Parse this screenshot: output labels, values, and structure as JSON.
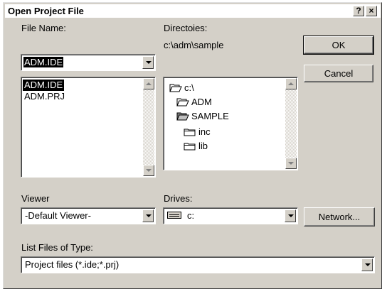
{
  "window": {
    "title": "Open Project File",
    "help_label": "?",
    "close_label": "×"
  },
  "file_name": {
    "label": "File Name:",
    "value": "ADM.IDE",
    "files": [
      "ADM.IDE",
      "ADM.PRJ"
    ]
  },
  "directories": {
    "label": "Directoies:",
    "current_path": "c:\\adm\\sample",
    "tree": [
      {
        "name": "c:\\",
        "icon": "folder-open-icon"
      },
      {
        "name": "ADM",
        "icon": "folder-open-icon"
      },
      {
        "name": "SAMPLE",
        "icon": "folder-open-shaded-icon"
      },
      {
        "name": "inc",
        "icon": "folder-closed-icon"
      },
      {
        "name": "lib",
        "icon": "folder-closed-icon"
      }
    ]
  },
  "buttons": {
    "ok": "OK",
    "cancel": "Cancel",
    "network": "Network..."
  },
  "viewer": {
    "label": "Viewer",
    "value": "-Default Viewer-"
  },
  "drives": {
    "label": "Drives:",
    "value": "c:",
    "icon": "drive-icon"
  },
  "file_type": {
    "label": "List Files of Type:",
    "value": "Project files (*.ide;*.prj)"
  }
}
